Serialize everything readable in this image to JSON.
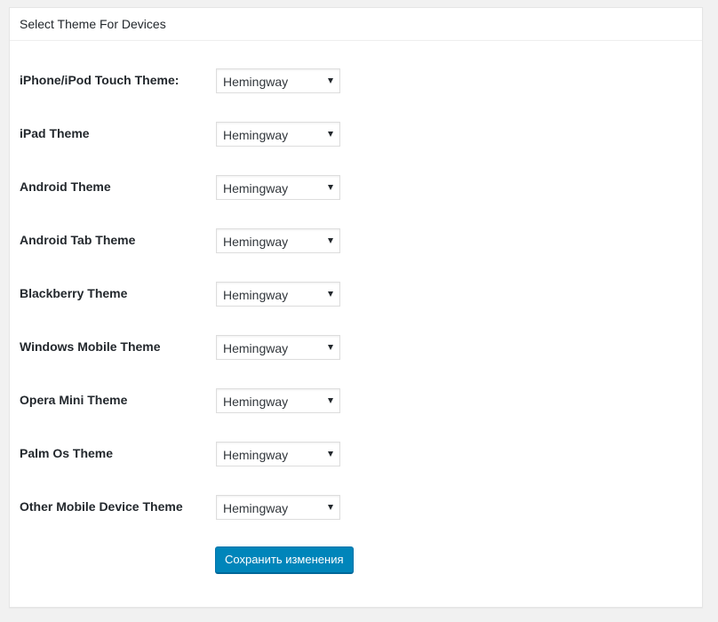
{
  "panel": {
    "title": "Select Theme For Devices"
  },
  "rows": [
    {
      "label": "iPhone/iPod Touch Theme:",
      "value": "Hemingway"
    },
    {
      "label": "iPad Theme",
      "value": "Hemingway"
    },
    {
      "label": "Android Theme",
      "value": "Hemingway"
    },
    {
      "label": "Android Tab Theme",
      "value": "Hemingway"
    },
    {
      "label": "Blackberry Theme",
      "value": "Hemingway"
    },
    {
      "label": "Windows Mobile Theme",
      "value": "Hemingway"
    },
    {
      "label": "Opera Mini Theme",
      "value": "Hemingway"
    },
    {
      "label": "Palm Os Theme",
      "value": "Hemingway"
    },
    {
      "label": "Other Mobile Device Theme",
      "value": "Hemingway"
    }
  ],
  "actions": {
    "save_label": "Сохранить изменения"
  },
  "colors": {
    "primary_button": "#0085ba",
    "page_background": "#f1f1f1",
    "panel_background": "#ffffff"
  },
  "icons": {
    "select_arrow": "chevron-down-icon"
  }
}
